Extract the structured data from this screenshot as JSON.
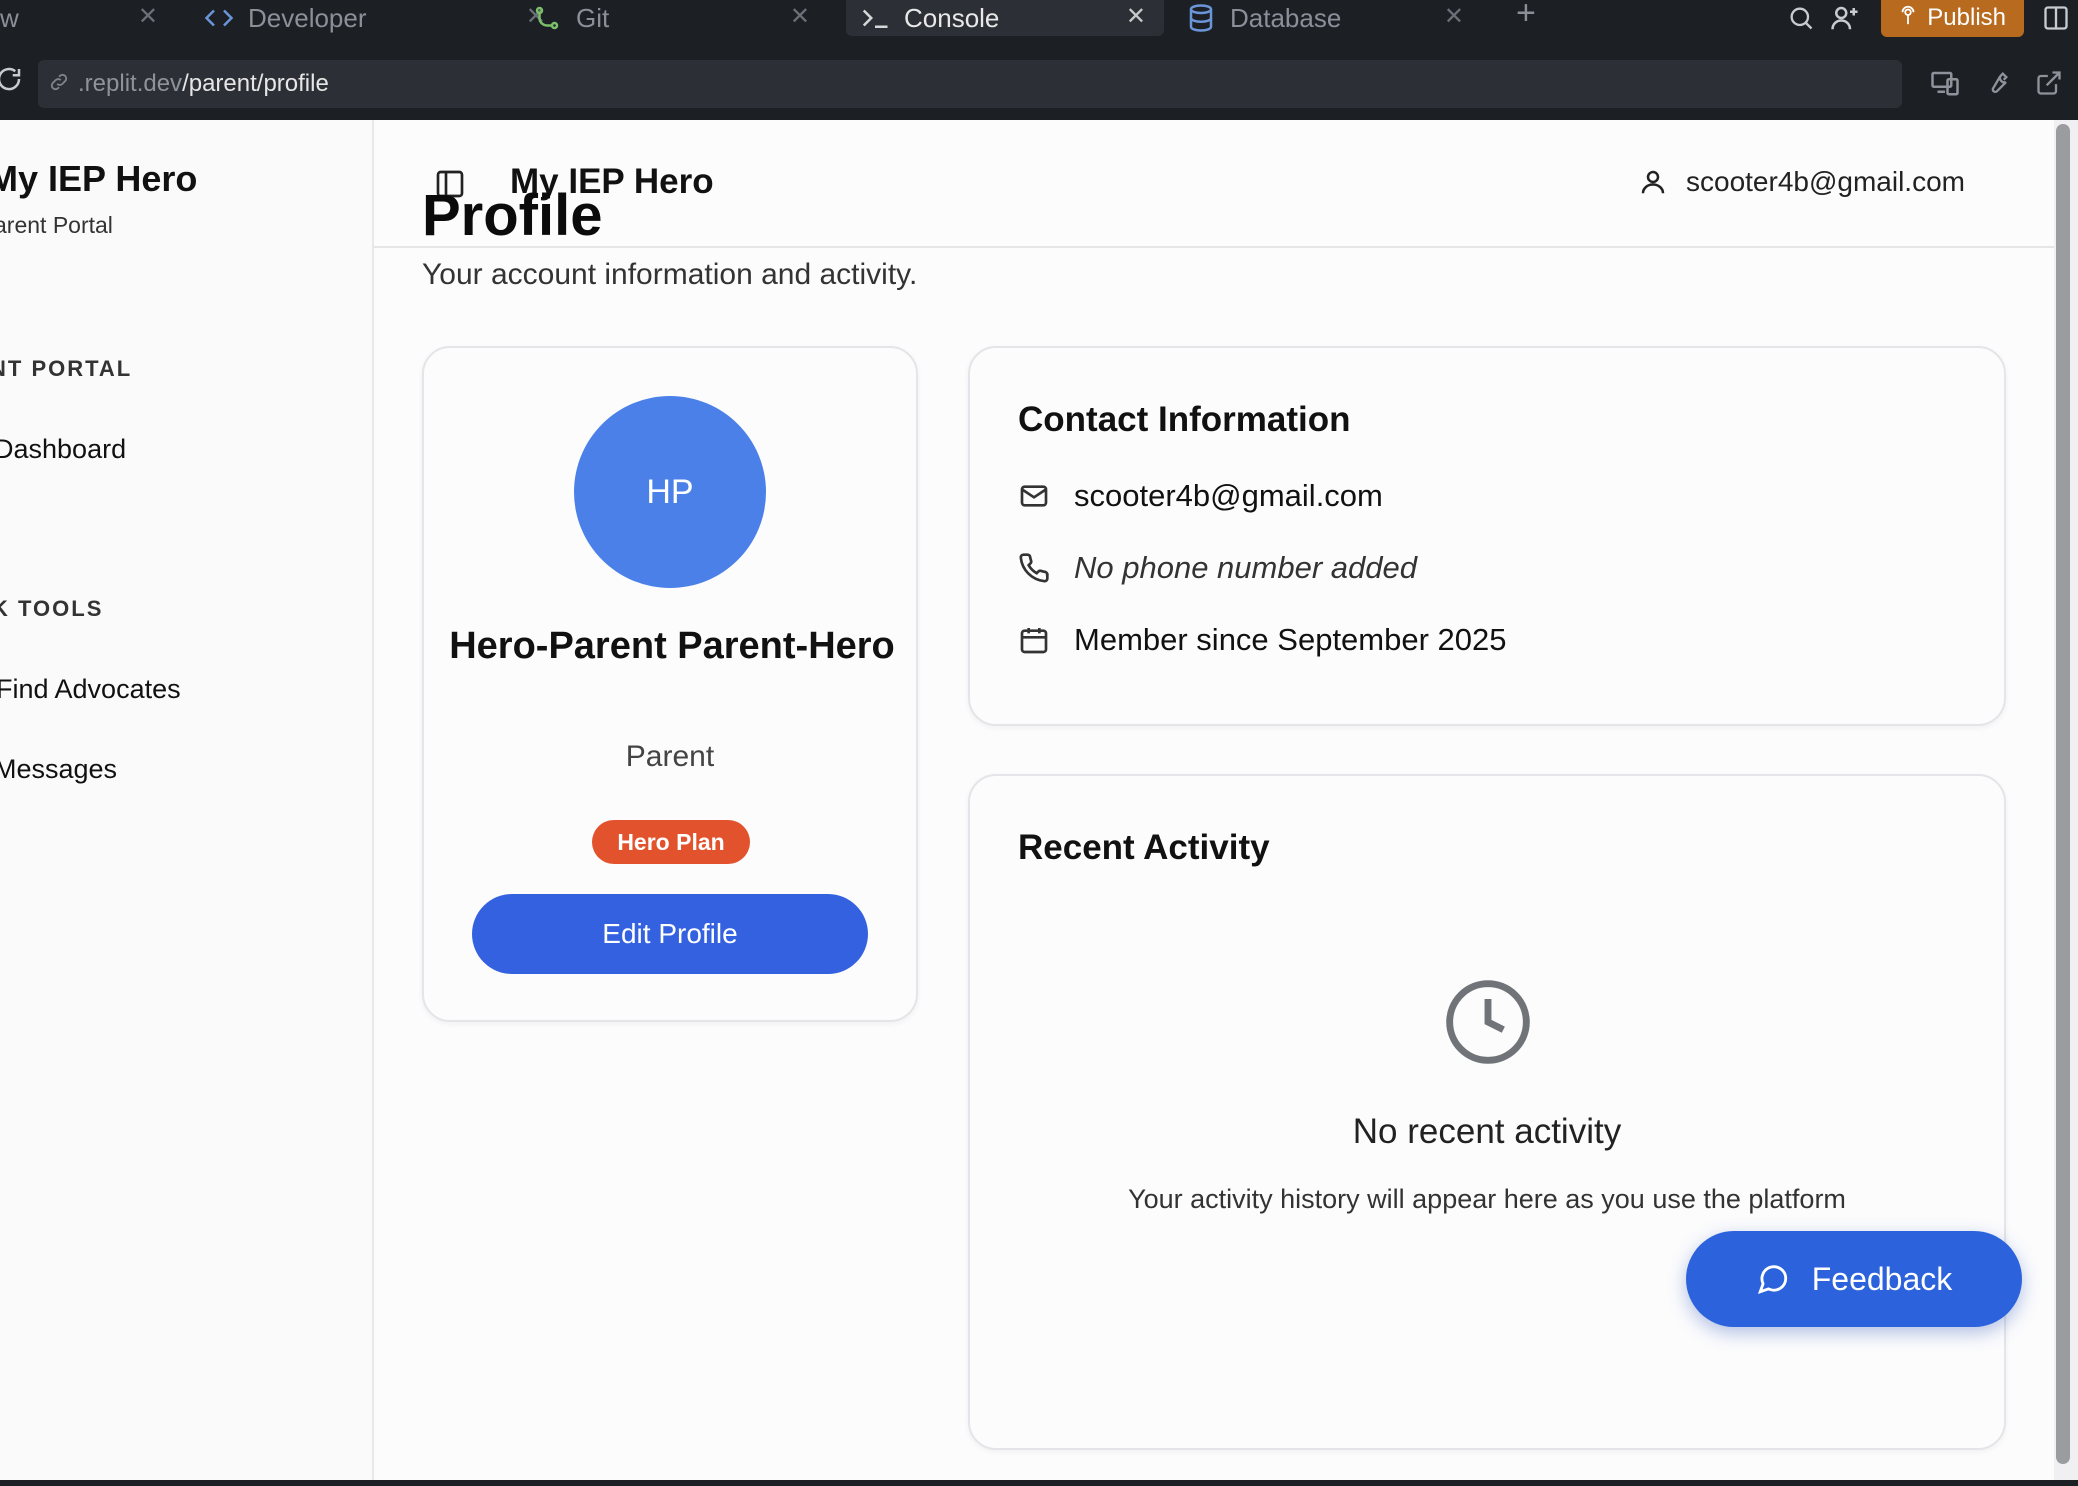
{
  "tabs": [
    {
      "label": "w",
      "icon": "webview-icon"
    },
    {
      "label": "Developer",
      "icon": "code-icon"
    },
    {
      "label": "Git",
      "icon": "git-icon"
    },
    {
      "label": "Console",
      "icon": "terminal-icon",
      "active": true
    },
    {
      "label": "Database",
      "icon": "database-icon"
    }
  ],
  "toolbar": {
    "publish_label": "Publish"
  },
  "url": {
    "host": ".replit.dev",
    "path": "/parent/profile"
  },
  "sidebar": {
    "brand_title": "My IEP Hero",
    "brand_sub": "arent Portal",
    "sections": [
      {
        "label": "NT PORTAL",
        "items": [
          "Dashboard"
        ]
      },
      {
        "label": "K TOOLS",
        "items": [
          "Find Advocates",
          "Messages"
        ]
      }
    ]
  },
  "header": {
    "title": "My IEP Hero",
    "user_email": "scooter4b@gmail.com"
  },
  "page": {
    "title": "Profile",
    "subtitle": "Your account information and activity."
  },
  "profile": {
    "initials": "HP",
    "name": "Hero-Parent Parent-Hero",
    "role": "Parent",
    "plan": "Hero Plan",
    "edit_label": "Edit Profile"
  },
  "contact": {
    "heading": "Contact Information",
    "email": "scooter4b@gmail.com",
    "phone": "No phone number added",
    "member_since": "Member since September 2025"
  },
  "activity": {
    "heading": "Recent Activity",
    "empty_title": "No recent activity",
    "empty_sub": "Your activity history will appear here as you use the platform"
  },
  "feedback_label": "Feedback",
  "colors": {
    "accent": "#3461df",
    "avatar": "#4b80e8",
    "plan_badge": "#e2532d",
    "publish": "#b86a1e"
  }
}
